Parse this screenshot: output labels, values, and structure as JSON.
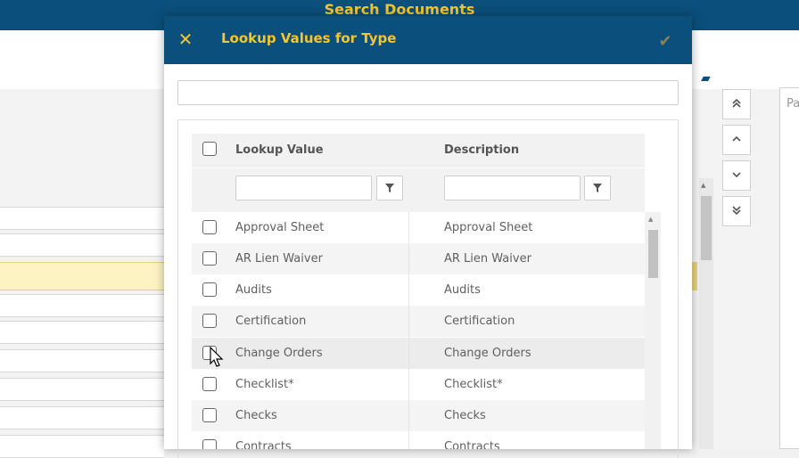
{
  "app": {
    "title": "Search Documents"
  },
  "right_panel": {
    "label": "Pa"
  },
  "nav_buttons": {
    "first": "«",
    "prev": "‹",
    "next": "›",
    "last": "»"
  },
  "modal": {
    "title": "Lookup Values for Type",
    "close_icon": "✕",
    "confirm_icon": "✔",
    "search": {
      "value": "",
      "placeholder": ""
    }
  },
  "grid": {
    "columns": [
      "Lookup Value",
      "Description"
    ],
    "filters": [
      {
        "value": "",
        "placeholder": ""
      },
      {
        "value": "",
        "placeholder": ""
      }
    ],
    "filter_icon": "funnel-icon",
    "rows": [
      {
        "value": "Approval Sheet",
        "description": "Approval Sheet"
      },
      {
        "value": "AR Lien Waiver",
        "description": "AR Lien Waiver"
      },
      {
        "value": "Audits",
        "description": "Audits"
      },
      {
        "value": "Certification",
        "description": "Certification"
      },
      {
        "value": "Change Orders",
        "description": "Change Orders"
      },
      {
        "value": "Checklist*",
        "description": "Checklist*"
      },
      {
        "value": "Checks",
        "description": "Checks"
      },
      {
        "value": "Contracts",
        "description": "Contracts"
      }
    ]
  },
  "colors": {
    "brand": "#0b4f7c",
    "accent": "#f6c52b",
    "confirm": "#8e7f53",
    "highlight_row": "#fdf3c2"
  }
}
